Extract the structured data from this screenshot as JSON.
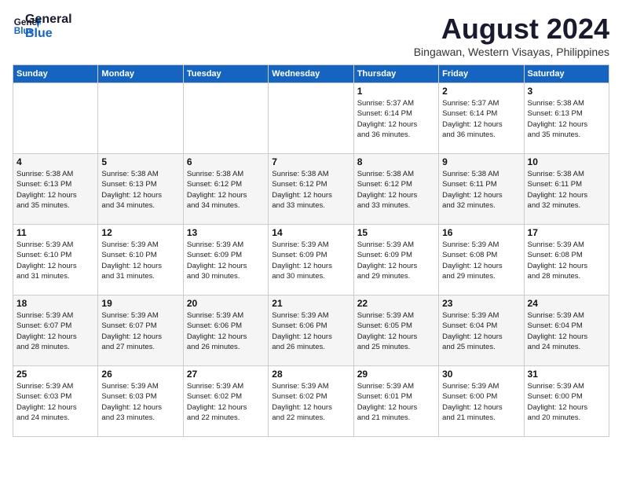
{
  "logo": {
    "line1": "General",
    "line2": "Blue"
  },
  "title": "August 2024",
  "location": "Bingawan, Western Visayas, Philippines",
  "days_of_week": [
    "Sunday",
    "Monday",
    "Tuesday",
    "Wednesday",
    "Thursday",
    "Friday",
    "Saturday"
  ],
  "weeks": [
    [
      {
        "day": "",
        "info": ""
      },
      {
        "day": "",
        "info": ""
      },
      {
        "day": "",
        "info": ""
      },
      {
        "day": "",
        "info": ""
      },
      {
        "day": "1",
        "info": "Sunrise: 5:37 AM\nSunset: 6:14 PM\nDaylight: 12 hours\nand 36 minutes."
      },
      {
        "day": "2",
        "info": "Sunrise: 5:37 AM\nSunset: 6:14 PM\nDaylight: 12 hours\nand 36 minutes."
      },
      {
        "day": "3",
        "info": "Sunrise: 5:38 AM\nSunset: 6:13 PM\nDaylight: 12 hours\nand 35 minutes."
      }
    ],
    [
      {
        "day": "4",
        "info": "Sunrise: 5:38 AM\nSunset: 6:13 PM\nDaylight: 12 hours\nand 35 minutes."
      },
      {
        "day": "5",
        "info": "Sunrise: 5:38 AM\nSunset: 6:13 PM\nDaylight: 12 hours\nand 34 minutes."
      },
      {
        "day": "6",
        "info": "Sunrise: 5:38 AM\nSunset: 6:12 PM\nDaylight: 12 hours\nand 34 minutes."
      },
      {
        "day": "7",
        "info": "Sunrise: 5:38 AM\nSunset: 6:12 PM\nDaylight: 12 hours\nand 33 minutes."
      },
      {
        "day": "8",
        "info": "Sunrise: 5:38 AM\nSunset: 6:12 PM\nDaylight: 12 hours\nand 33 minutes."
      },
      {
        "day": "9",
        "info": "Sunrise: 5:38 AM\nSunset: 6:11 PM\nDaylight: 12 hours\nand 32 minutes."
      },
      {
        "day": "10",
        "info": "Sunrise: 5:38 AM\nSunset: 6:11 PM\nDaylight: 12 hours\nand 32 minutes."
      }
    ],
    [
      {
        "day": "11",
        "info": "Sunrise: 5:39 AM\nSunset: 6:10 PM\nDaylight: 12 hours\nand 31 minutes."
      },
      {
        "day": "12",
        "info": "Sunrise: 5:39 AM\nSunset: 6:10 PM\nDaylight: 12 hours\nand 31 minutes."
      },
      {
        "day": "13",
        "info": "Sunrise: 5:39 AM\nSunset: 6:09 PM\nDaylight: 12 hours\nand 30 minutes."
      },
      {
        "day": "14",
        "info": "Sunrise: 5:39 AM\nSunset: 6:09 PM\nDaylight: 12 hours\nand 30 minutes."
      },
      {
        "day": "15",
        "info": "Sunrise: 5:39 AM\nSunset: 6:09 PM\nDaylight: 12 hours\nand 29 minutes."
      },
      {
        "day": "16",
        "info": "Sunrise: 5:39 AM\nSunset: 6:08 PM\nDaylight: 12 hours\nand 29 minutes."
      },
      {
        "day": "17",
        "info": "Sunrise: 5:39 AM\nSunset: 6:08 PM\nDaylight: 12 hours\nand 28 minutes."
      }
    ],
    [
      {
        "day": "18",
        "info": "Sunrise: 5:39 AM\nSunset: 6:07 PM\nDaylight: 12 hours\nand 28 minutes."
      },
      {
        "day": "19",
        "info": "Sunrise: 5:39 AM\nSunset: 6:07 PM\nDaylight: 12 hours\nand 27 minutes."
      },
      {
        "day": "20",
        "info": "Sunrise: 5:39 AM\nSunset: 6:06 PM\nDaylight: 12 hours\nand 26 minutes."
      },
      {
        "day": "21",
        "info": "Sunrise: 5:39 AM\nSunset: 6:06 PM\nDaylight: 12 hours\nand 26 minutes."
      },
      {
        "day": "22",
        "info": "Sunrise: 5:39 AM\nSunset: 6:05 PM\nDaylight: 12 hours\nand 25 minutes."
      },
      {
        "day": "23",
        "info": "Sunrise: 5:39 AM\nSunset: 6:04 PM\nDaylight: 12 hours\nand 25 minutes."
      },
      {
        "day": "24",
        "info": "Sunrise: 5:39 AM\nSunset: 6:04 PM\nDaylight: 12 hours\nand 24 minutes."
      }
    ],
    [
      {
        "day": "25",
        "info": "Sunrise: 5:39 AM\nSunset: 6:03 PM\nDaylight: 12 hours\nand 24 minutes."
      },
      {
        "day": "26",
        "info": "Sunrise: 5:39 AM\nSunset: 6:03 PM\nDaylight: 12 hours\nand 23 minutes."
      },
      {
        "day": "27",
        "info": "Sunrise: 5:39 AM\nSunset: 6:02 PM\nDaylight: 12 hours\nand 22 minutes."
      },
      {
        "day": "28",
        "info": "Sunrise: 5:39 AM\nSunset: 6:02 PM\nDaylight: 12 hours\nand 22 minutes."
      },
      {
        "day": "29",
        "info": "Sunrise: 5:39 AM\nSunset: 6:01 PM\nDaylight: 12 hours\nand 21 minutes."
      },
      {
        "day": "30",
        "info": "Sunrise: 5:39 AM\nSunset: 6:00 PM\nDaylight: 12 hours\nand 21 minutes."
      },
      {
        "day": "31",
        "info": "Sunrise: 5:39 AM\nSunset: 6:00 PM\nDaylight: 12 hours\nand 20 minutes."
      }
    ]
  ]
}
